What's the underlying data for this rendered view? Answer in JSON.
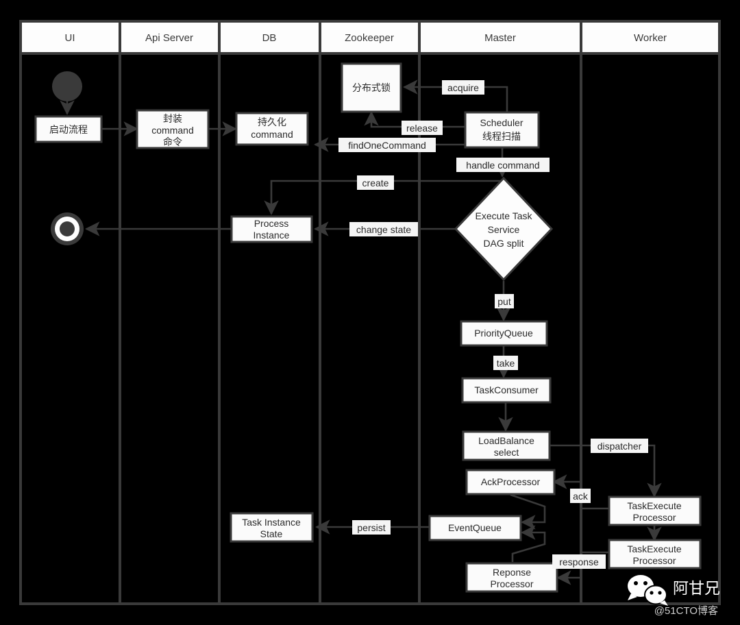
{
  "diagram": {
    "title": "DolphinScheduler task execution flow",
    "type": "swimlane-flowchart",
    "colors": {
      "background": "#000000",
      "stroke": "#3a3a3a",
      "node_fill": "#fbfbfb",
      "node_text": "#2b2b2b",
      "label_fill": "#f5f5f5",
      "start_node_fill": "#3a3a3a",
      "watermark_text": "#ffffff"
    }
  },
  "lanes": [
    {
      "id": "ui",
      "label": "UI"
    },
    {
      "id": "api-server",
      "label": "Api Server"
    },
    {
      "id": "db",
      "label": "DB"
    },
    {
      "id": "zookeeper",
      "label": "Zookeeper"
    },
    {
      "id": "master",
      "label": "Master"
    },
    {
      "id": "worker",
      "label": "Worker"
    }
  ],
  "nodes": [
    {
      "id": "start",
      "lane": "ui",
      "shape": "start-circle",
      "label": ""
    },
    {
      "id": "start-process",
      "lane": "ui",
      "shape": "rect",
      "label": "启动流程"
    },
    {
      "id": "end",
      "lane": "ui",
      "shape": "end-circle",
      "label": ""
    },
    {
      "id": "wrap-command",
      "lane": "api-server",
      "shape": "rect",
      "lines": [
        "封装",
        "command",
        "命令"
      ]
    },
    {
      "id": "persist-command",
      "lane": "db",
      "shape": "rect",
      "lines": [
        "持久化",
        "command"
      ]
    },
    {
      "id": "process-instance",
      "lane": "db",
      "shape": "rect",
      "lines": [
        "Process",
        "Instance"
      ]
    },
    {
      "id": "task-instance-state",
      "lane": "db",
      "shape": "rect",
      "lines": [
        "Task Instance",
        "State"
      ]
    },
    {
      "id": "distributed-lock",
      "lane": "zookeeper",
      "shape": "rect",
      "lines": [
        "分布式锁"
      ]
    },
    {
      "id": "scheduler",
      "lane": "master",
      "shape": "rect",
      "lines": [
        "Scheduler",
        "线程扫描"
      ]
    },
    {
      "id": "execute-task-service",
      "lane": "master",
      "shape": "diamond",
      "lines": [
        "Execute Task",
        "Service",
        "DAG split"
      ]
    },
    {
      "id": "priority-queue",
      "lane": "master",
      "shape": "rect",
      "lines": [
        "PriorityQueue"
      ]
    },
    {
      "id": "task-consumer",
      "lane": "master",
      "shape": "rect",
      "lines": [
        "TaskConsumer"
      ]
    },
    {
      "id": "load-balance",
      "lane": "master",
      "shape": "rect",
      "lines": [
        "LoadBalance",
        "select"
      ]
    },
    {
      "id": "ack-processor",
      "lane": "master",
      "shape": "rect",
      "lines": [
        "AckProcessor"
      ]
    },
    {
      "id": "event-queue",
      "lane": "master",
      "shape": "rect",
      "lines": [
        "EventQueue"
      ]
    },
    {
      "id": "reponse-processor",
      "lane": "master",
      "shape": "rect",
      "lines": [
        "Reponse",
        "Processor"
      ]
    },
    {
      "id": "task-execute-processor-1",
      "lane": "worker",
      "shape": "rect",
      "lines": [
        "TaskExecute",
        "Processor"
      ]
    },
    {
      "id": "task-execute-processor-2",
      "lane": "worker",
      "shape": "rect",
      "lines": [
        "TaskExecute",
        "Processor"
      ]
    }
  ],
  "edges": [
    {
      "id": "e-acquire",
      "label": "acquire",
      "from": "scheduler",
      "to": "distributed-lock"
    },
    {
      "id": "e-release",
      "label": "release",
      "from": "scheduler",
      "to": "distributed-lock"
    },
    {
      "id": "e-find-one-command",
      "label": "findOneCommand",
      "from": "scheduler",
      "to": "persist-command"
    },
    {
      "id": "e-handle-command",
      "label": "handle command",
      "from": "scheduler",
      "to": "execute-task-service"
    },
    {
      "id": "e-create",
      "label": "create",
      "from": "execute-task-service",
      "to": "process-instance"
    },
    {
      "id": "e-change-state",
      "label": "change state",
      "from": "execute-task-service",
      "to": "process-instance"
    },
    {
      "id": "e-put",
      "label": "put",
      "from": "execute-task-service",
      "to": "priority-queue"
    },
    {
      "id": "e-take",
      "label": "take",
      "from": "priority-queue",
      "to": "task-consumer"
    },
    {
      "id": "e-consume",
      "label": "",
      "from": "task-consumer",
      "to": "load-balance"
    },
    {
      "id": "e-dispatcher",
      "label": "dispatcher",
      "from": "load-balance",
      "to": "task-execute-processor-1"
    },
    {
      "id": "e-ack",
      "label": "ack",
      "from": "task-execute-processor-1",
      "to": "ack-processor"
    },
    {
      "id": "e-response",
      "label": "response",
      "from": "task-execute-processor-2",
      "to": "reponse-processor"
    },
    {
      "id": "e-persist",
      "label": "persist",
      "from": "event-queue",
      "to": "task-instance-state"
    }
  ],
  "watermark": {
    "name": "阿甘兄",
    "source": "@51CTO博客",
    "icon": "wechat-icon"
  }
}
